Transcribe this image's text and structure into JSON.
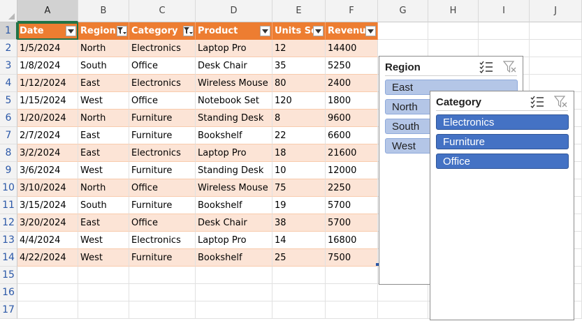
{
  "columns": [
    "A",
    "B",
    "C",
    "D",
    "E",
    "F",
    "G",
    "H",
    "I",
    "J"
  ],
  "rows": [
    "1",
    "2",
    "3",
    "4",
    "5",
    "6",
    "7",
    "8",
    "9",
    "10",
    "11",
    "12",
    "13",
    "14",
    "15",
    "16",
    "17"
  ],
  "table": {
    "headers": [
      {
        "label": "Date",
        "filter": "dropdown"
      },
      {
        "label": "Region",
        "filter": "filtered"
      },
      {
        "label": "Category",
        "filter": "filtered"
      },
      {
        "label": "Product",
        "filter": "dropdown"
      },
      {
        "label": "Units Sol",
        "filter": "dropdown"
      },
      {
        "label": "Revenue",
        "filter": "dropdown"
      }
    ],
    "data": [
      [
        "1/5/2024",
        "North",
        "Electronics",
        "Laptop Pro",
        "12",
        "14400"
      ],
      [
        "1/8/2024",
        "South",
        "Office",
        "Desk Chair",
        "35",
        "5250"
      ],
      [
        "1/12/2024",
        "East",
        "Electronics",
        "Wireless Mouse",
        "80",
        "2400"
      ],
      [
        "1/15/2024",
        "West",
        "Office",
        "Notebook Set",
        "120",
        "1800"
      ],
      [
        "1/20/2024",
        "North",
        "Furniture",
        "Standing Desk",
        "8",
        "9600"
      ],
      [
        "2/7/2024",
        "East",
        "Furniture",
        "Bookshelf",
        "22",
        "6600"
      ],
      [
        "3/2/2024",
        "East",
        "Electronics",
        "Laptop Pro",
        "18",
        "21600"
      ],
      [
        "3/6/2024",
        "West",
        "Furniture",
        "Standing Desk",
        "10",
        "12000"
      ],
      [
        "3/10/2024",
        "North",
        "Office",
        "Wireless Mouse",
        "75",
        "2250"
      ],
      [
        "3/15/2024",
        "South",
        "Furniture",
        "Bookshelf",
        "19",
        "5700"
      ],
      [
        "3/20/2024",
        "East",
        "Office",
        "Desk Chair",
        "38",
        "5700"
      ],
      [
        "4/4/2024",
        "West",
        "Electronics",
        "Laptop Pro",
        "14",
        "16800"
      ],
      [
        "4/22/2024",
        "West",
        "Furniture",
        "Bookshelf",
        "25",
        "7500"
      ]
    ]
  },
  "slicers": {
    "region": {
      "title": "Region",
      "items": [
        "East",
        "North",
        "South",
        "West"
      ]
    },
    "category": {
      "title": "Category",
      "items": [
        "Electronics",
        "Furniture",
        "Office"
      ]
    }
  },
  "icons": {
    "multi_select": "multi-select-icon",
    "clear_filter": "clear-filter-icon",
    "filter_dropdown": "dropdown-arrow-icon",
    "filter_applied": "filter-applied-icon"
  },
  "colors": {
    "table_header": "#ed7d31",
    "band_row": "#fce4d6",
    "selection": "#217346",
    "slicer_selected": "#4472c4",
    "slicer_item": "#b4c6e7"
  }
}
